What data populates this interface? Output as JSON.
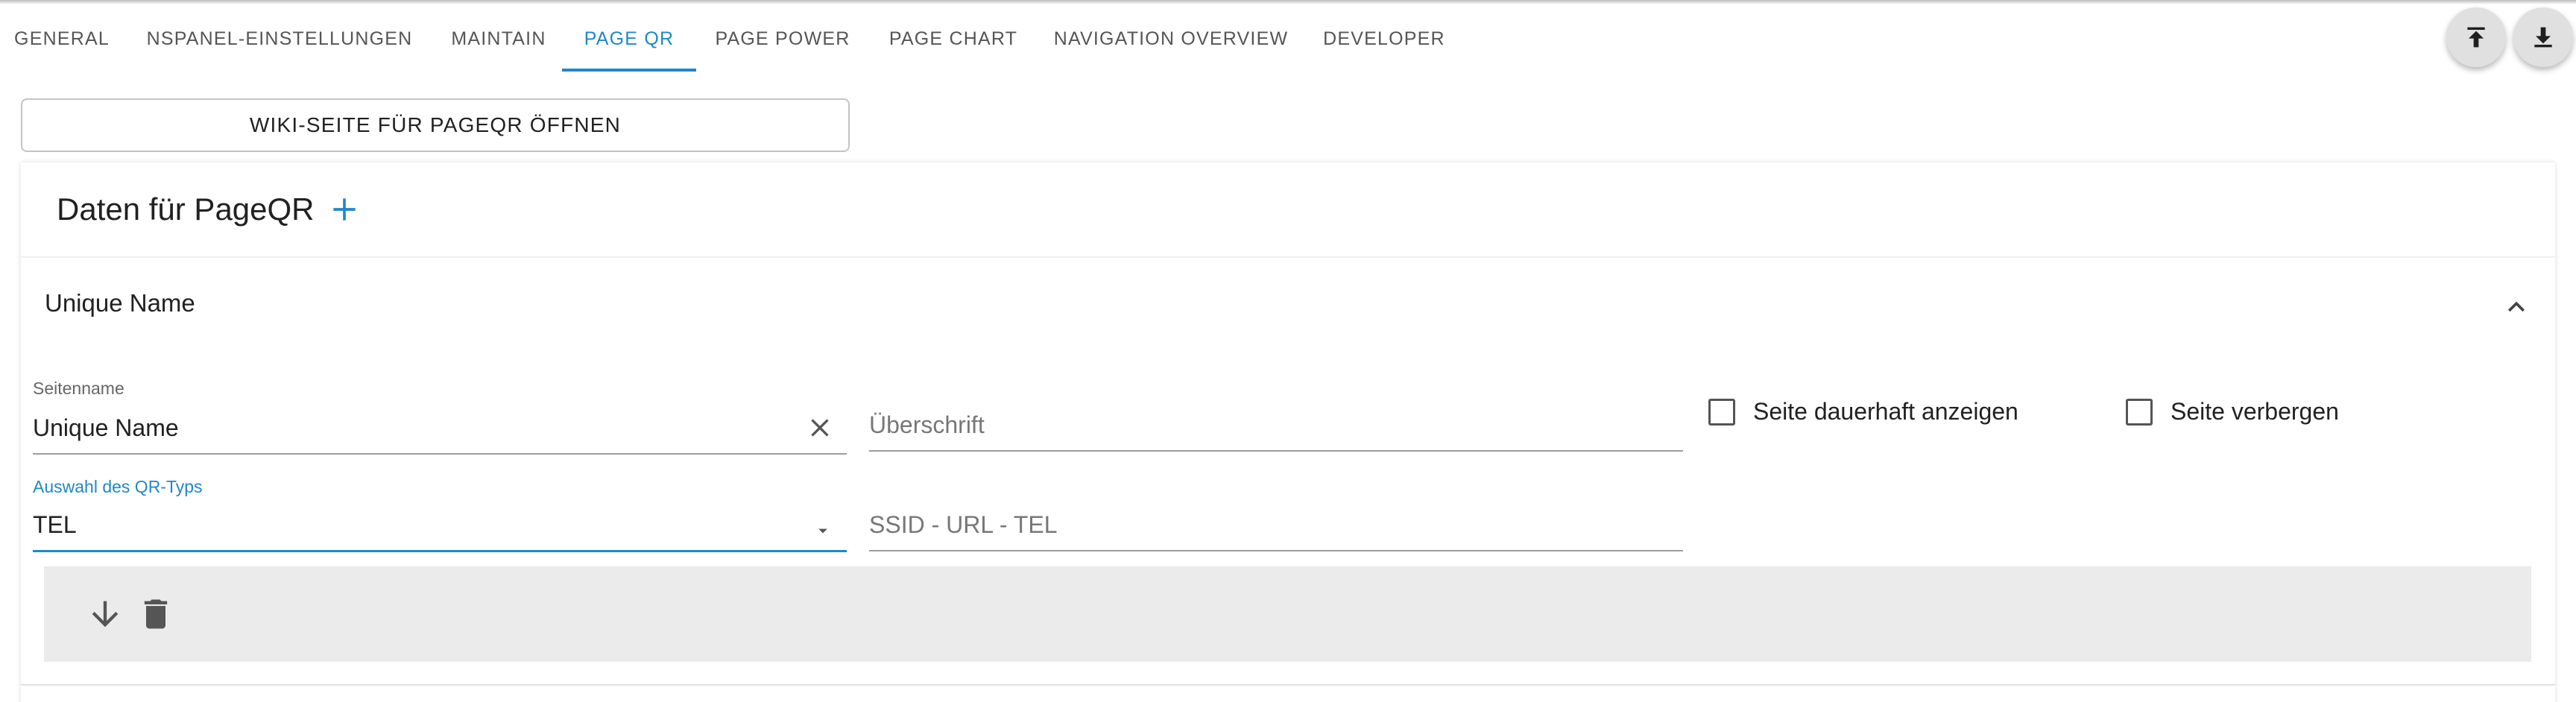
{
  "tabs": [
    {
      "label": "GENERAL"
    },
    {
      "label": "NSPANEL-EINSTELLUNGEN"
    },
    {
      "label": "MAINTAIN"
    },
    {
      "label": "PAGE QR"
    },
    {
      "label": "PAGE POWER"
    },
    {
      "label": "PAGE CHART"
    },
    {
      "label": "NAVIGATION OVERVIEW"
    },
    {
      "label": "DEVELOPER"
    }
  ],
  "active_tab": "PAGE QR",
  "toolbar": {
    "upload_icon": "upload-icon",
    "download_icon": "download-icon"
  },
  "wiki_button": {
    "label": "WIKI-SEITE FÜR PAGEQR ÖFFNEN"
  },
  "card": {
    "title": "Daten für PageQR",
    "add_icon": "plus-icon",
    "accordion": {
      "title": "Unique Name",
      "expanded": true,
      "fields": {
        "seitenname": {
          "label": "Seitenname",
          "value": "Unique Name"
        },
        "ueberschrift": {
          "placeholder": "Überschrift",
          "value": ""
        },
        "qr_type": {
          "label": "Auswahl des QR-Typs",
          "value": "TEL"
        },
        "ssid": {
          "placeholder": "SSID - URL - TEL",
          "value": ""
        }
      },
      "checkboxes": {
        "dauerhaft": {
          "label": "Seite dauerhaft anzeigen",
          "checked": false
        },
        "verbergen": {
          "label": "Seite verbergen",
          "checked": false
        }
      }
    }
  },
  "colors": {
    "accent": "#1e88c8",
    "action_bar": "#ebebeb",
    "text": "#212121"
  }
}
